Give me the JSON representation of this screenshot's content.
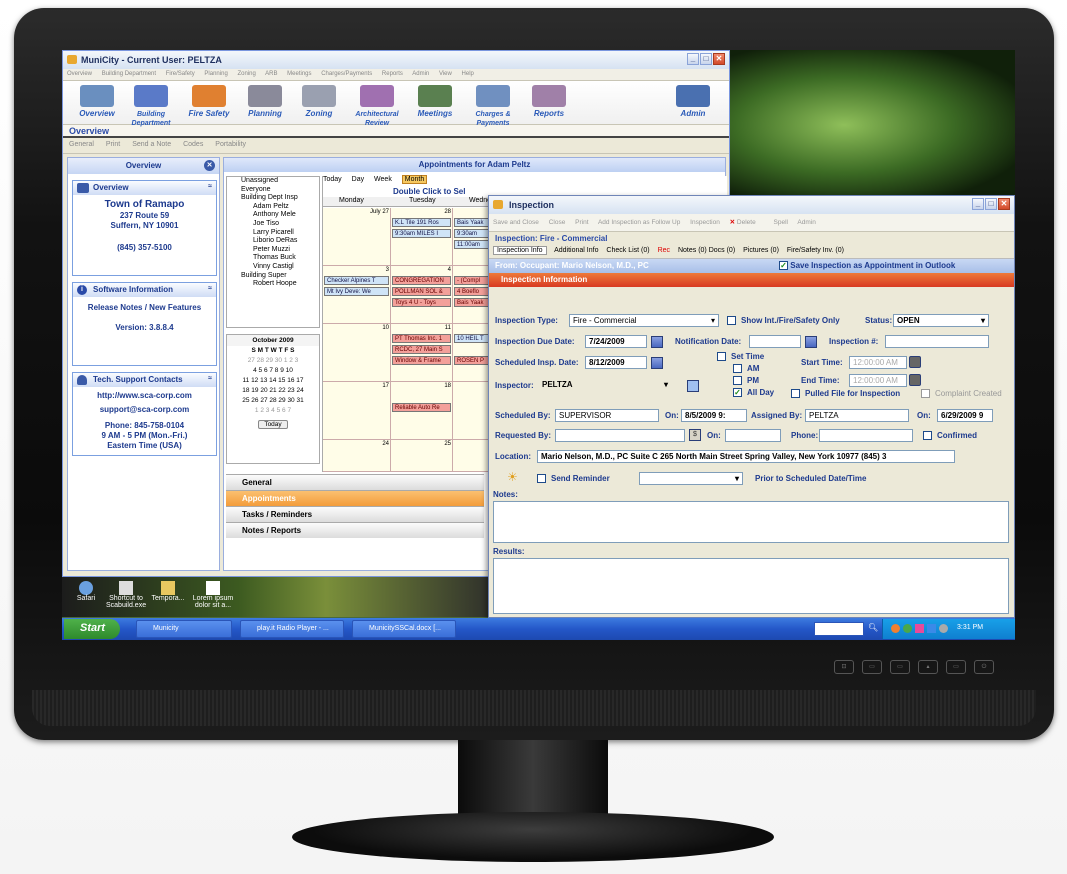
{
  "main_window": {
    "title": "MuniCity - Current User: PELTZA",
    "menu": [
      "Overview",
      "Building Department",
      "Fire/Safety",
      "Planning",
      "Zoning",
      "ARB",
      "Meetings",
      "Charges/Payments",
      "Reports",
      "Admin",
      "View",
      "Help"
    ],
    "ribbon": [
      {
        "label": "Overview",
        "color": "#6a8fbf"
      },
      {
        "label": "Building Department",
        "color": "#5a7ac8"
      },
      {
        "label": "Fire Safety",
        "color": "#e08030"
      },
      {
        "label": "Planning",
        "color": "#8a8a9a"
      },
      {
        "label": "Zoning",
        "color": "#9aa0b0"
      },
      {
        "label": "Architectural Review",
        "color": "#a070b0"
      },
      {
        "label": "Meetings",
        "color": "#5a8050"
      },
      {
        "label": "Charges & Payments",
        "color": "#7090c0"
      },
      {
        "label": "Reports",
        "color": "#a080a8"
      },
      {
        "label": "Admin",
        "color": "#4a70b0"
      }
    ],
    "section_header": "Overview",
    "toolbar": [
      "General",
      "Print",
      "Send a Note",
      "Codes",
      "Portability"
    ]
  },
  "left_pane": {
    "title": "Overview",
    "overview_panel": {
      "title": "Overview",
      "town": "Town of Ramapo",
      "address1": "237 Route 59",
      "address2": "Suffern, NY 10901",
      "phone": "(845) 357-5100"
    },
    "software_panel": {
      "title": "Software Information",
      "release_notes": "Release Notes / New Features",
      "version": "Version: 3.8.8.4"
    },
    "support_panel": {
      "title": "Tech. Support Contacts",
      "url": "http://www.sca-corp.com",
      "email": "support@sca-corp.com",
      "phone": "Phone: 845-758-0104",
      "hours": "9 AM - 5 PM (Mon.-Fri.)",
      "timezone": "Eastern Time (USA)"
    }
  },
  "calendar": {
    "title": "Appointments for Adam Peltz",
    "views": [
      "Today",
      "Day",
      "Week",
      "Month"
    ],
    "hint": "Double Click to Sel",
    "folders": [
      "Unassigned",
      "Everyone",
      "Building Dept Insp",
      "Adam Peltz",
      "Anthony Mele",
      "Joe Tiso",
      "Larry Picarell",
      "Liborio DeRas",
      "Peter Muzzi",
      "Thomas Buck",
      "Vinny Castigl",
      "Building Super",
      "Robert Hoope"
    ],
    "minical": {
      "month": "October 2009",
      "dow": "S M T W T F S",
      "weeks": [
        "27 28 29 30 1 2 3",
        "4 5 6 7 8 9 10",
        "11 12 13 14 15 16 17",
        "18 19 20 21 22 23 24",
        "25 26 27 28 29 30 31",
        "1 2 3 4 5 6 7"
      ],
      "today": "Today"
    },
    "columns": [
      "Monday",
      "Tuesday",
      "Wedne"
    ],
    "day_numbers": [
      "July 27",
      "28",
      "3",
      "4",
      "10",
      "11",
      "17",
      "18",
      "24",
      "25"
    ],
    "appointments": [
      {
        "text": "K.L Tile 191 Ros",
        "color": "b"
      },
      {
        "text": "Bais Yaak",
        "color": "b"
      },
      {
        "text": "9:30am  MILES I",
        "color": "b"
      },
      {
        "text": "9:30am",
        "color": "b"
      },
      {
        "text": "11:00am",
        "color": "b"
      },
      {
        "text": "Checker Alpines T",
        "color": "b"
      },
      {
        "text": "CONGREGATION",
        "color": "r"
      },
      {
        "text": "- (Compl",
        "color": "r"
      },
      {
        "text": "Mt Ivy Deve: We",
        "color": "b"
      },
      {
        "text": "POLLMAN SOL &",
        "color": "r"
      },
      {
        "text": "4 Boeflo",
        "color": "r"
      },
      {
        "text": "Toys 4 U - Toys",
        "color": "r"
      },
      {
        "text": "Bais Yaak",
        "color": "r"
      },
      {
        "text": "PT Thomas Inc. 1",
        "color": "r"
      },
      {
        "text": "10 HEIL T",
        "color": "b"
      },
      {
        "text": "RCDC, 27 Main S",
        "color": "r"
      },
      {
        "text": "Window & Frame",
        "color": "r"
      },
      {
        "text": "ROSEN P",
        "color": "r"
      },
      {
        "text": "Reliable Auto Re",
        "color": "r"
      }
    ],
    "nav": [
      "General",
      "Appointments",
      "Tasks / Reminders",
      "Notes / Reports"
    ]
  },
  "desktop": {
    "icons": [
      "Safari",
      "Shortcut to Scabuild.exe",
      "Tempora...",
      "Lorem ipsum dolor sit a..."
    ]
  },
  "taskbar": {
    "start": "Start",
    "items": [
      "Municity",
      "play.it Radio Player - ...",
      "MunicitySSCal.docx [..."
    ],
    "clock": "3:31 PM"
  },
  "inspection": {
    "title": "Inspection",
    "toolbar": [
      "Save and Close",
      "Close",
      "Print",
      "Add Inspection as Follow Up",
      "Inspection",
      "Delete",
      "Spell",
      "Admin"
    ],
    "heading": "Inspection: Fire - Commercial",
    "tabs": [
      "Inspection Info",
      "Additional Info",
      "Check List (0)",
      "Rec",
      "Notes (0) Docs (0)",
      "Pictures (0)",
      "Fire/Safety Inv. (0)"
    ],
    "occupant": "From: Occupant: Mario Nelson, M.D., PC",
    "save_appt_label": "Save Inspection as Appointment in Outlook",
    "section": "Inspection Information",
    "type_label": "Inspection Type:",
    "type_value": "Fire - Commercial",
    "show_int_label": "Show Int./Fire/Safety Only",
    "status_label": "Status:",
    "status_value": "OPEN",
    "due_label": "Inspection Due Date:",
    "due_value": "7/24/2009",
    "notif_label": "Notification Date:",
    "notif_value": "",
    "insp_no_label": "Inspection #:",
    "insp_no_value": "",
    "sched_label": "Scheduled Insp. Date:",
    "sched_value": "8/12/2009",
    "set_time_label": "Set Time",
    "am_label": "AM",
    "pm_label": "PM",
    "allday_label": "All Day",
    "start_label": "Start Time:",
    "start_value": "12:00:00 AM",
    "end_label": "End Time:",
    "end_value": "12:00:00 AM",
    "inspector_label": "Inspector:",
    "inspector_value": "PELTZA",
    "pulled_label": "Pulled File for Inspection",
    "complaint_label": "Complaint Created",
    "sched_by_label": "Scheduled By:",
    "sched_by_value": "SUPERVISOR",
    "on_label": "On:",
    "sched_on_value": "8/5/2009 9:",
    "assigned_label": "Assigned By:",
    "assigned_value": "PELTZA",
    "assigned_on_value": "6/29/2009 9",
    "requested_label": "Requested By:",
    "requested_value": "",
    "req_on_value": "",
    "phone_label": "Phone:",
    "phone_value": "",
    "confirmed_label": "Confirmed",
    "location_label": "Location:",
    "location_value": "Mario Nelson, M.D., PC Suite C 265 North Main Street Spring Valley, New York 10977 (845) 3",
    "reminder_label": "Send Reminder",
    "reminder_value": "",
    "prior_label": "Prior to Scheduled Date/Time",
    "notes_label": "Notes:",
    "results_label": "Results:"
  }
}
